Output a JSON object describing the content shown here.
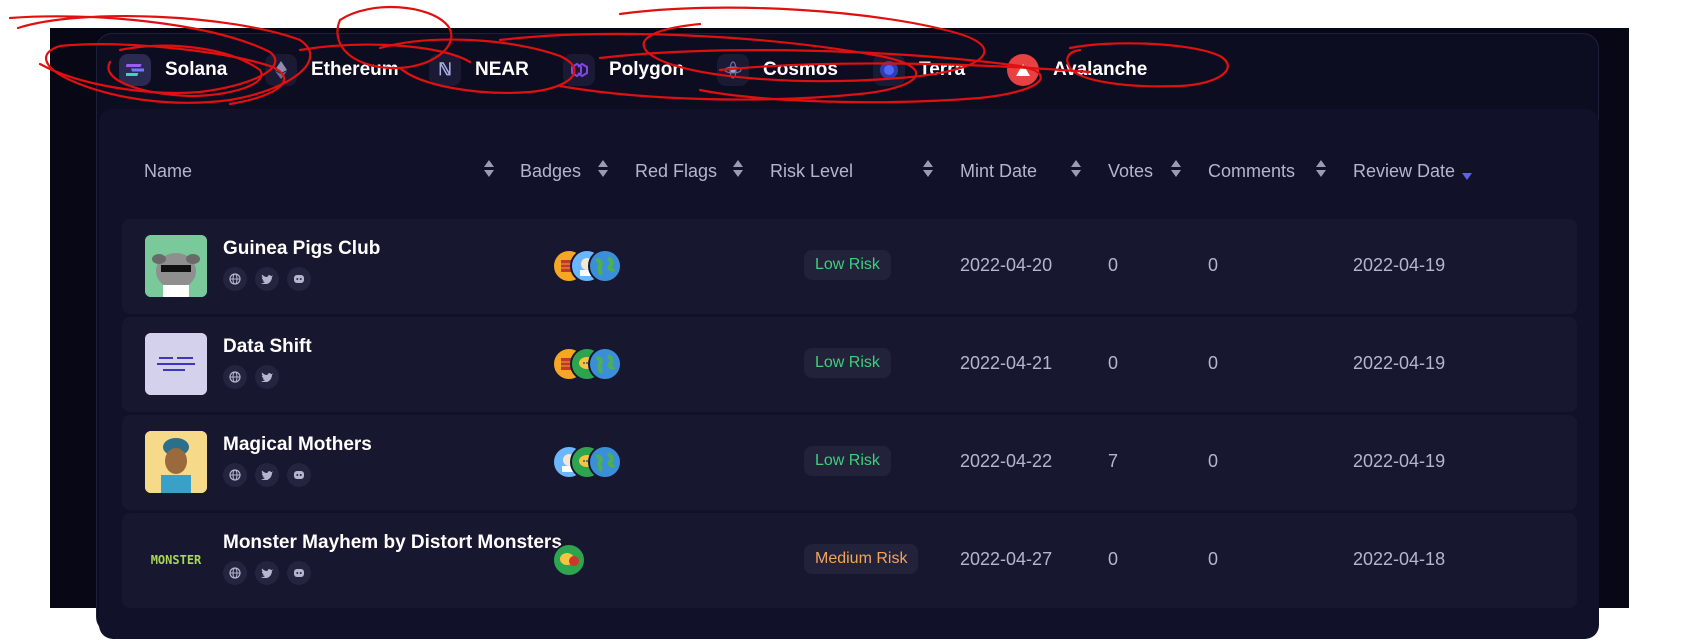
{
  "chains": [
    {
      "label": "Solana",
      "icon": "solana-icon"
    },
    {
      "label": "Ethereum",
      "icon": "ethereum-icon"
    },
    {
      "label": "NEAR",
      "icon": "near-icon"
    },
    {
      "label": "Polygon",
      "icon": "polygon-icon"
    },
    {
      "label": "Cosmos",
      "icon": "cosmos-icon"
    },
    {
      "label": "Terra",
      "icon": "terra-icon"
    },
    {
      "label": "Avalanche",
      "icon": "avalanche-icon"
    }
  ],
  "table": {
    "columns": [
      "Name",
      "Badges",
      "Red Flags",
      "Risk Level",
      "Mint Date",
      "Votes",
      "Comments",
      "Review Date"
    ],
    "sort": {
      "column": "Review Date",
      "direction": "desc"
    },
    "rows": [
      {
        "name": "Guinea Pigs Club",
        "risk": "Low Risk",
        "mint_date": "2022-04-20",
        "votes": "0",
        "comments": "0",
        "review_date": "2022-04-19",
        "socials": [
          "website",
          "twitter",
          "discord"
        ],
        "badges": 3
      },
      {
        "name": "Data Shift",
        "risk": "Low Risk",
        "mint_date": "2022-04-21",
        "votes": "0",
        "comments": "0",
        "review_date": "2022-04-19",
        "socials": [
          "website",
          "twitter"
        ],
        "badges": 3
      },
      {
        "name": "Magical Mothers",
        "risk": "Low Risk",
        "mint_date": "2022-04-22",
        "votes": "7",
        "comments": "0",
        "review_date": "2022-04-19",
        "socials": [
          "website",
          "twitter",
          "discord"
        ],
        "badges": 3
      },
      {
        "name": "Monster Mayhem by Distort Monsters",
        "risk": "Medium Risk",
        "mint_date": "2022-04-27",
        "votes": "0",
        "comments": "0",
        "review_date": "2022-04-18",
        "socials": [
          "website",
          "twitter",
          "discord"
        ],
        "badges": 1,
        "avatar_text": "MONSTER"
      }
    ]
  },
  "colors": {
    "background": "#070716",
    "panel": "#0d0d22",
    "row": "#17172f",
    "low_risk": "#3fcf7b",
    "medium_risk": "#f3a45e",
    "sort_active": "#5b63e8",
    "annotation": "#e01010"
  }
}
